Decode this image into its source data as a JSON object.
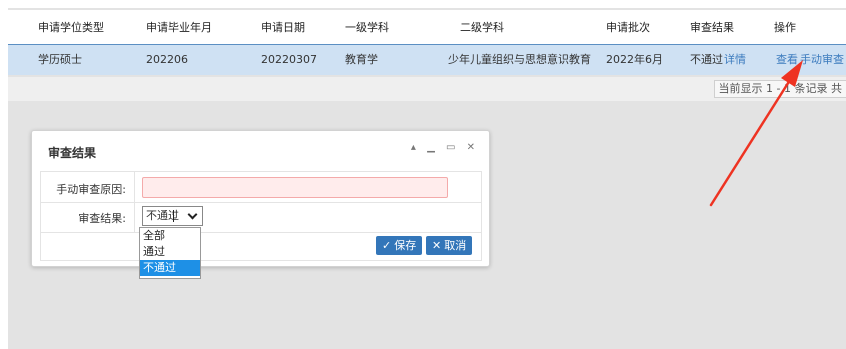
{
  "grid": {
    "columns": [
      "申请学位类型",
      "申请毕业年月",
      "申请日期",
      "一级学科",
      "二级学科",
      "申请批次",
      "审查结果",
      "操作"
    ],
    "row": {
      "degree_type": "学历硕士",
      "graduation_month": "202206",
      "apply_date": "20220307",
      "first_subject": "教育学",
      "second_subject": "少年儿童组织与思想意识教育",
      "batch": "2022年6月",
      "review_result": "不通过",
      "detail_link": "详情",
      "view_link": "查看",
      "manual_review_link": "手动审查"
    }
  },
  "pager": {
    "text": "当前显示 1 - 1 条记录 共"
  },
  "dialog": {
    "title": "审查结果",
    "controls": "▴ ▁ ▭ ✕",
    "reason_label": "手动审查原因:",
    "reason_value": "",
    "result_label": "审查结果:",
    "result_selected": "不通过",
    "options": [
      "全部",
      "通过",
      "不通过"
    ],
    "save_label": "保存",
    "cancel_label": "取消"
  },
  "colors": {
    "accent": "#3376b9",
    "selected_option": "#1e90e6",
    "annotation_arrow": "#ee3322"
  }
}
